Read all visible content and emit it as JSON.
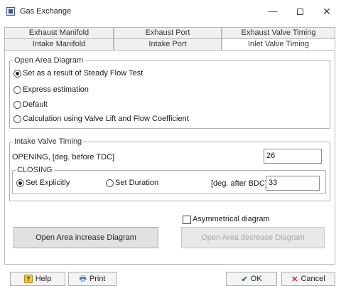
{
  "window": {
    "title": "Gas Exchange",
    "minimize": "—",
    "close": "✕"
  },
  "tabs": {
    "row1": [
      "Exhaust Manifold",
      "Exhaust Port",
      "Exhaust Valve Timing"
    ],
    "row2": [
      "Intake Manifold",
      "Intake Port",
      "Inlet Valve Timing"
    ],
    "active": "Inlet Valve Timing"
  },
  "open_area": {
    "legend": "Open Area Diagram",
    "options": [
      {
        "label": "Set as a result of Steady Flow Test",
        "checked": true
      },
      {
        "label": "Express estimation",
        "checked": false
      },
      {
        "label": "Default",
        "checked": false
      },
      {
        "label": "Calculation using Valve Lift and Flow Coefficient",
        "checked": false
      }
    ]
  },
  "intake_timing": {
    "legend": "Intake Valve Timing",
    "opening_label": "OPENING, [deg. before TDC]",
    "opening_value": "26",
    "closing": {
      "legend": "CLOSING",
      "set_explicitly": "Set Explicitly",
      "set_duration": "Set Duration",
      "unit_label": "[deg. after BDC]",
      "value": "33"
    }
  },
  "asymmetrical": {
    "label": "Asymmetrical diagram",
    "checked": false
  },
  "buttons": {
    "increase": "Open Area increase Diagram",
    "decrease": "Open Area decrease Diagram",
    "help": "Help",
    "print": "Print",
    "ok": "OK",
    "cancel": "Cancel"
  },
  "icons": {
    "help": "question-mark-icon",
    "print": "printer-icon",
    "ok": "checkmark-icon",
    "cancel": "x-icon"
  }
}
